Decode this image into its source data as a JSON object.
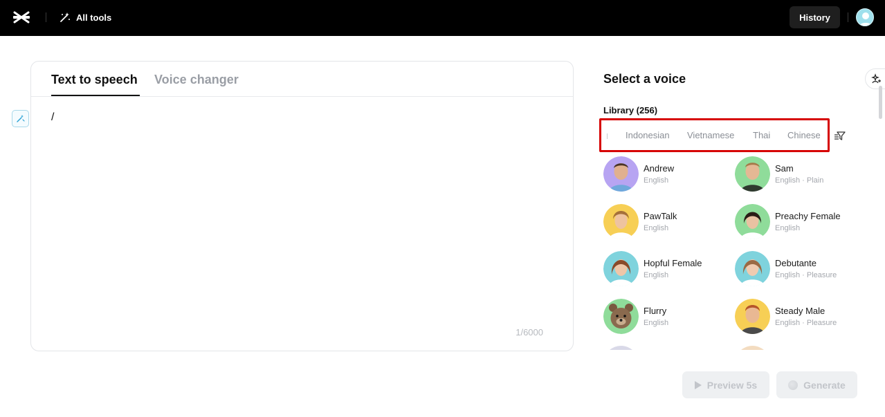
{
  "header": {
    "all_tools_label": "All tools",
    "history_label": "History"
  },
  "editor": {
    "tabs": [
      {
        "label": "Text to speech",
        "active": true
      },
      {
        "label": "Voice changer",
        "active": false
      }
    ],
    "text": "/",
    "counter": "1/6000"
  },
  "voice_panel": {
    "title": "Select a voice",
    "library_label": "Library (256)",
    "languages": [
      "Indonesian",
      "Vietnamese",
      "Thai",
      "Chinese"
    ],
    "voices": [
      {
        "name": "Andrew",
        "meta": "English",
        "avatar_color": "#b7a4f2"
      },
      {
        "name": "Sam",
        "meta": "English · Plain",
        "avatar_color": "#8fdc9a"
      },
      {
        "name": "PawTalk",
        "meta": "English",
        "avatar_color": "#f7cf55"
      },
      {
        "name": "Preachy Female",
        "meta": "English",
        "avatar_color": "#8fdc9a"
      },
      {
        "name": "Hopful Female",
        "meta": "English",
        "avatar_color": "#7fd3dd"
      },
      {
        "name": "Debutante",
        "meta": "English · Pleasure",
        "avatar_color": "#7fd3dd"
      },
      {
        "name": "Flurry",
        "meta": "English",
        "avatar_color": "#8fdc9a"
      },
      {
        "name": "Steady Male",
        "meta": "English · Pleasure",
        "avatar_color": "#f7cf55"
      }
    ]
  },
  "actions": {
    "preview_label": "Preview 5s",
    "generate_label": "Generate"
  },
  "colors": {
    "header_bg": "#000000",
    "highlight_border": "#d60000",
    "disabled_button_bg": "#eef0f2"
  }
}
